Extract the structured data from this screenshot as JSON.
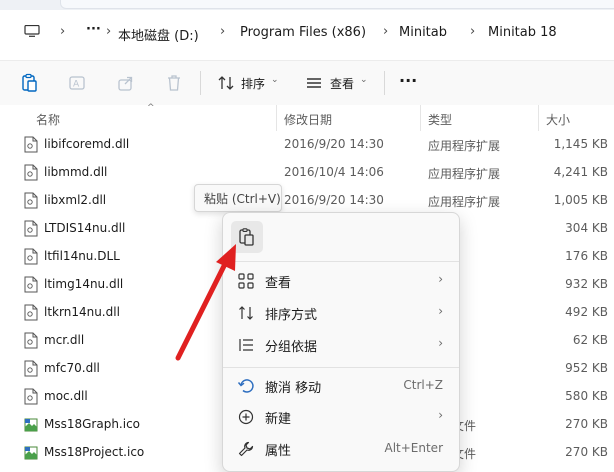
{
  "address_bar": {
    "path": [
      "本地磁盘 (D:)",
      "Program Files (x86)",
      "Minitab",
      "Minitab 18"
    ],
    "more": "···"
  },
  "toolbar": {
    "sort_label": "排序",
    "view_label": "查看",
    "more_label": "···"
  },
  "columns": {
    "name": "名称",
    "date": "修改日期",
    "type": "类型",
    "size": "大小"
  },
  "files": [
    {
      "name": "libifcoremd.dll",
      "date": "2016/9/20 14:30",
      "type": "应用程序扩展",
      "size": "1,145 KB",
      "icon": "dll-icon"
    },
    {
      "name": "libmmd.dll",
      "date": "2016/10/4 14:06",
      "type": "应用程序扩展",
      "size": "4,241 KB",
      "icon": "dll-icon"
    },
    {
      "name": "libxml2.dll",
      "date": "2016/9/20 14:30",
      "type": "应用程序扩展",
      "size": "1,005 KB",
      "icon": "dll-icon"
    },
    {
      "name": "LTDIS14nu.dll",
      "date": "",
      "type": "",
      "size": "304 KB",
      "icon": "dll-icon"
    },
    {
      "name": "ltfil14nu.DLL",
      "date": "",
      "type": "",
      "size": "176 KB",
      "icon": "dll-icon"
    },
    {
      "name": "ltimg14nu.dll",
      "date": "",
      "type": "",
      "size": "932 KB",
      "icon": "dll-icon"
    },
    {
      "name": "ltkrn14nu.dll",
      "date": "",
      "type": "",
      "size": "492 KB",
      "icon": "dll-icon"
    },
    {
      "name": "mcr.dll",
      "date": "",
      "type": "",
      "size": "62 KB",
      "icon": "dll-icon"
    },
    {
      "name": "mfc70.dll",
      "date": "",
      "type": "",
      "size": "952 KB",
      "icon": "dll-icon"
    },
    {
      "name": "moc.dll",
      "date": "",
      "type": "",
      "size": "580 KB",
      "icon": "dll-icon"
    },
    {
      "name": "Mss18Graph.ico",
      "date": "",
      "type": "图片文件",
      "size": "270 KB",
      "icon": "ico-icon"
    },
    {
      "name": "Mss18Project.ico",
      "date": "",
      "type": "图片文件",
      "size": "270 KB",
      "icon": "ico-icon"
    }
  ],
  "tooltip": {
    "text": "粘贴 (Ctrl+V)"
  },
  "context_menu": {
    "items": [
      {
        "label": "查看",
        "shortcut": "",
        "submenu": true
      },
      {
        "label": "排序方式",
        "shortcut": "",
        "submenu": true
      },
      {
        "label": "分组依据",
        "shortcut": "",
        "submenu": true
      },
      {
        "label": "撤消 移动",
        "shortcut": "Ctrl+Z",
        "submenu": false
      },
      {
        "label": "新建",
        "shortcut": "",
        "submenu": true
      },
      {
        "label": "属性",
        "shortcut": "Alt+Enter",
        "submenu": false
      }
    ],
    "arrow_glyph": "›"
  },
  "colors": {
    "accent": "#0067c0",
    "annotation_arrow": "#e02020"
  }
}
